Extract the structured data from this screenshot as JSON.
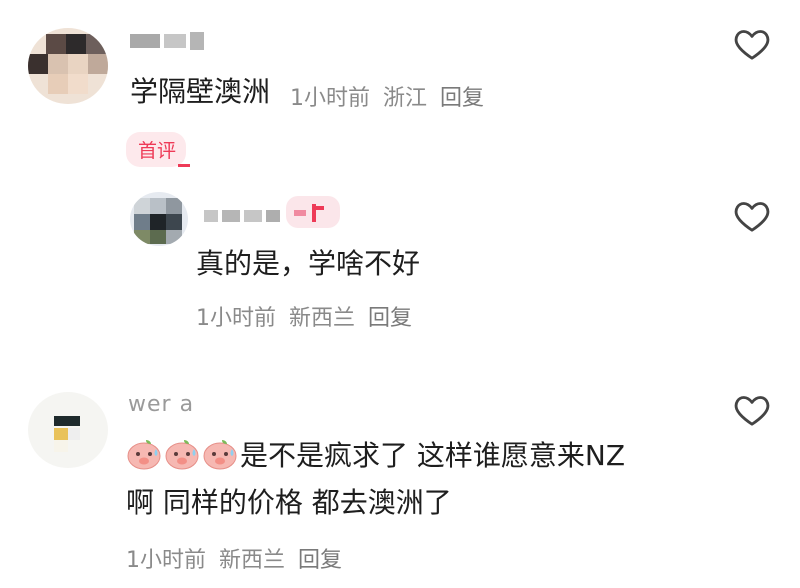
{
  "comments": [
    {
      "author": "",
      "text": "学隔壁澳洲",
      "time": "1小时前",
      "location": "浙江",
      "reply_label": "回复",
      "badge": "首评",
      "like_icon": "heart-outline-icon"
    },
    {
      "author": "",
      "text": "真的是，学啥不好",
      "time": "1小时前",
      "location": "新西兰",
      "reply_label": "回复",
      "like_icon": "heart-outline-icon"
    },
    {
      "author": "wer a",
      "emoji": [
        "pig-sweat-emoji",
        "pig-sweat-emoji",
        "pig-sweat-emoji"
      ],
      "text_line1": "是不是疯求了 这样谁愿意来NZ",
      "text_line2": "啊 同样的价格 都去澳洲了",
      "time": "1小时前",
      "location": "新西兰",
      "reply_label": "回复",
      "like_icon": "heart-outline-icon"
    }
  ],
  "colors": {
    "accent": "#ee3a57",
    "meta": "#8a8a8a",
    "badge_bg": "#fde9ec"
  }
}
